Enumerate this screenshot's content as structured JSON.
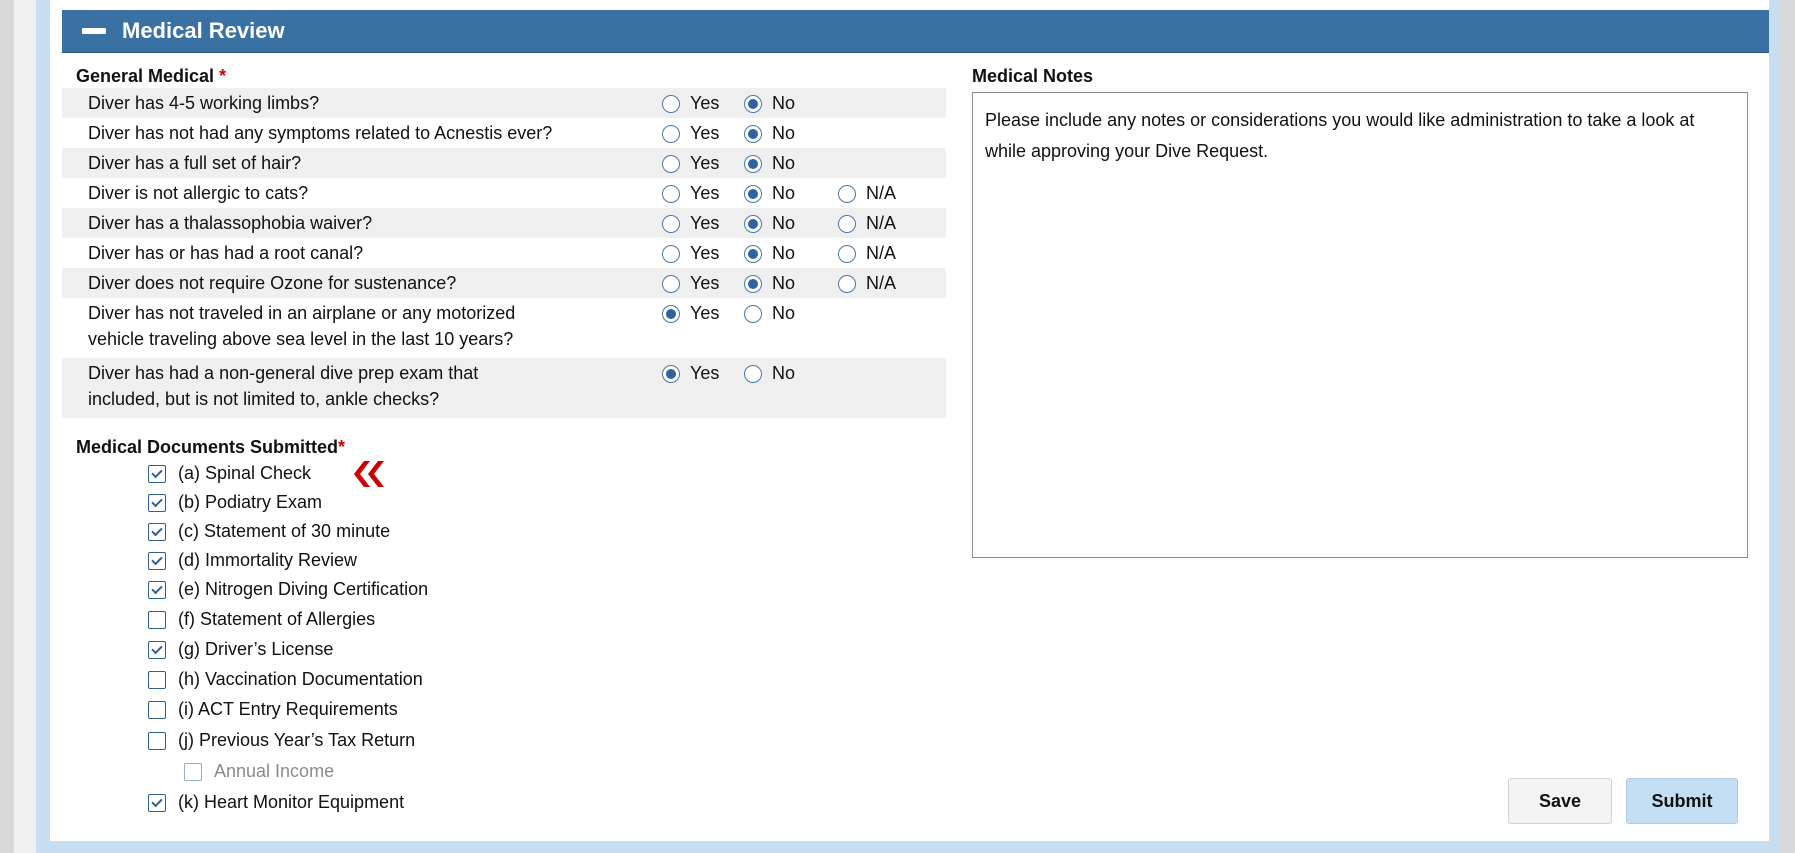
{
  "section": {
    "title": "Medical Review"
  },
  "general_medical": {
    "label": "General Medical",
    "required_marker": "*",
    "questions": [
      {
        "text": "Diver has 4-5 working limbs?",
        "options": [
          "Yes",
          "No"
        ],
        "selected": "No"
      },
      {
        "text": "Diver has not had any symptoms related to Acnestis ever?",
        "options": [
          "Yes",
          "No"
        ],
        "selected": "No"
      },
      {
        "text": "Diver has a full set of hair?",
        "options": [
          "Yes",
          "No"
        ],
        "selected": "No"
      },
      {
        "text": "Diver is not allergic to cats?",
        "options": [
          "Yes",
          "No",
          "N/A"
        ],
        "selected": "No"
      },
      {
        "text": "Diver has a thalassophobia waiver?",
        "options": [
          "Yes",
          "No",
          "N/A"
        ],
        "selected": "No"
      },
      {
        "text": "Diver has or has had a root canal?",
        "options": [
          "Yes",
          "No",
          "N/A"
        ],
        "selected": "No"
      },
      {
        "text": "Diver does not require Ozone for sustenance?",
        "options": [
          "Yes",
          "No",
          "N/A"
        ],
        "selected": "No"
      },
      {
        "text_line1": "Diver has not traveled in an airplane or any motorized",
        "text_line2": "vehicle traveling above sea level in the last 10 years?",
        "options": [
          "Yes",
          "No"
        ],
        "selected": "Yes"
      },
      {
        "text_line1": "Diver has had a non-general dive prep exam that",
        "text_line2": "included, but is not limited to, ankle checks?",
        "options": [
          "Yes",
          "No"
        ],
        "selected": "Yes"
      }
    ]
  },
  "documents": {
    "label": "Medical Documents Submitted",
    "required_marker": "*",
    "items": [
      {
        "label": "(a) Spinal Check",
        "checked": true
      },
      {
        "label": "(b) Podiatry Exam",
        "checked": true
      },
      {
        "label": "(c) Statement of 30 minute",
        "checked": true
      },
      {
        "label": "(d) Immortality Review",
        "checked": true
      },
      {
        "label": "(e) Nitrogen Diving Certification",
        "checked": true
      },
      {
        "label": "(f) Statement of Allergies",
        "checked": false
      },
      {
        "label": "(g) Driver’s License",
        "checked": true
      },
      {
        "label": "(h) Vaccination Documentation",
        "checked": false
      },
      {
        "label": "(i) ACT Entry Requirements",
        "checked": false
      },
      {
        "label": "(j) Previous Year’s Tax Return",
        "checked": false
      },
      {
        "label": "Annual Income",
        "checked": false,
        "disabled": true
      },
      {
        "label": "(k) Heart Monitor Equipment",
        "checked": true
      }
    ]
  },
  "notes": {
    "label": "Medical Notes",
    "value": "Please include any notes or considerations you would like administration to take a look at while approving your Dive Request."
  },
  "buttons": {
    "save": "Save",
    "submit": "Submit"
  },
  "colors": {
    "header": "#3a71a3",
    "accent": "#2e62a0",
    "arrow": "#d10000"
  }
}
